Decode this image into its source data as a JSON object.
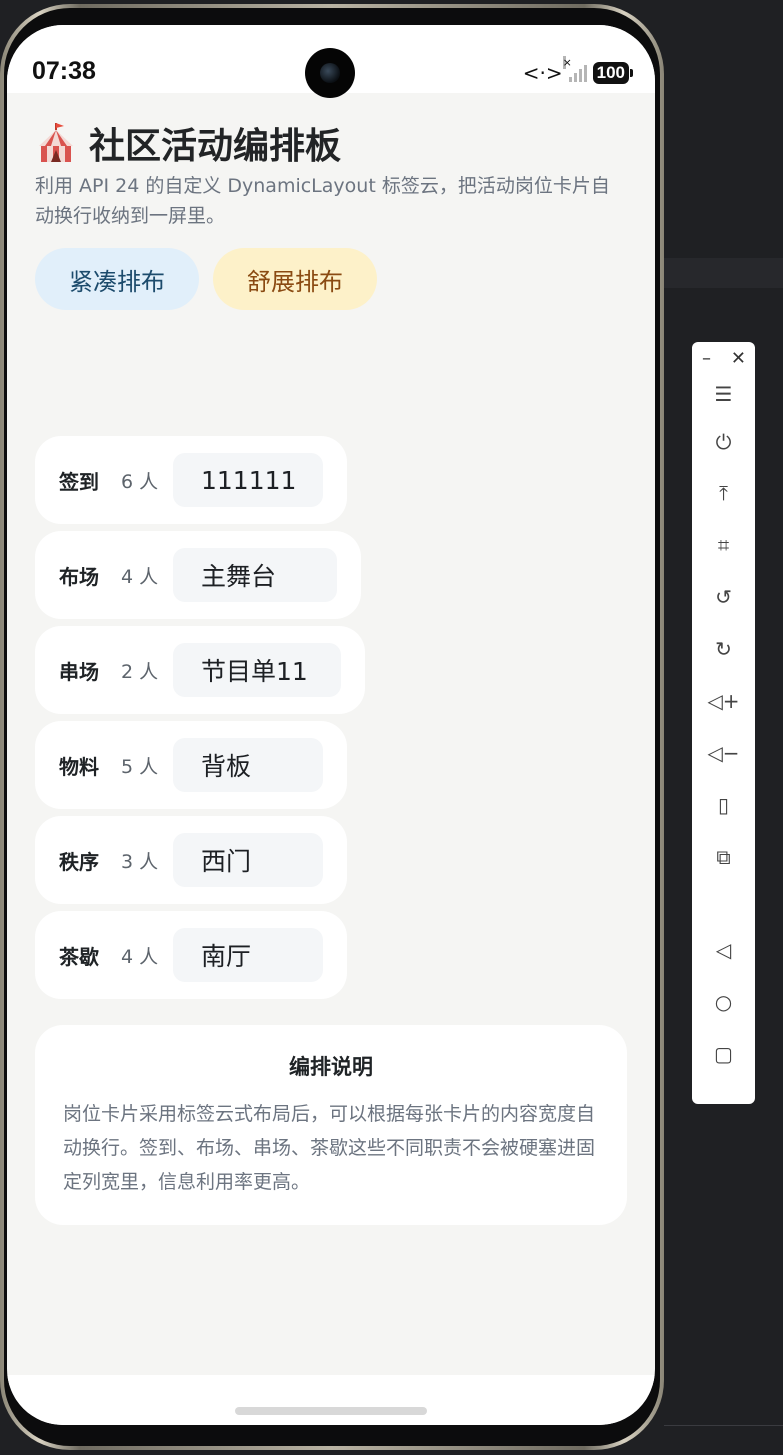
{
  "status_bar": {
    "time": "07:38",
    "battery": "100",
    "icons": [
      "data-arrows-icon",
      "signal-icon",
      "battery-icon"
    ]
  },
  "header": {
    "icon": "circus-tent-icon",
    "title": "社区活动编排板",
    "subtitle": "利用 API 24 的自定义 DynamicLayout 标签云，把活动岗位卡片自动换行收纳到一屏里。"
  },
  "modes": {
    "compact_label": "紧凑排布",
    "spacious_label": "舒展排布"
  },
  "cards": [
    {
      "role": "签到",
      "count": "6 人",
      "value": "111111"
    },
    {
      "role": "布场",
      "count": "4 人",
      "value": "主舞台"
    },
    {
      "role": "串场",
      "count": "2 人",
      "value": "节目单11"
    },
    {
      "role": "物料",
      "count": "5 人",
      "value": "背板"
    },
    {
      "role": "秩序",
      "count": "3 人",
      "value": "西门"
    },
    {
      "role": "茶歇",
      "count": "4 人",
      "value": "南厅"
    }
  ],
  "note": {
    "title": "编排说明",
    "body": "岗位卡片采用标签云式布局后，可以根据每张卡片的内容宽度自动换行。签到、布场、串场、茶歇这些不同职责不会被硬塞进固定列宽里，信息利用率更高。"
  },
  "emulator_toolbar": {
    "items": [
      "minimize-icon",
      "close-icon",
      "menu-icon",
      "power-icon",
      "pin-top-icon",
      "crop-icon",
      "rotate-left-icon",
      "rotate-right-icon",
      "volume-up-icon",
      "volume-down-icon",
      "shake-icon",
      "multi-device-icon",
      "back-icon",
      "home-icon",
      "recents-icon"
    ]
  }
}
